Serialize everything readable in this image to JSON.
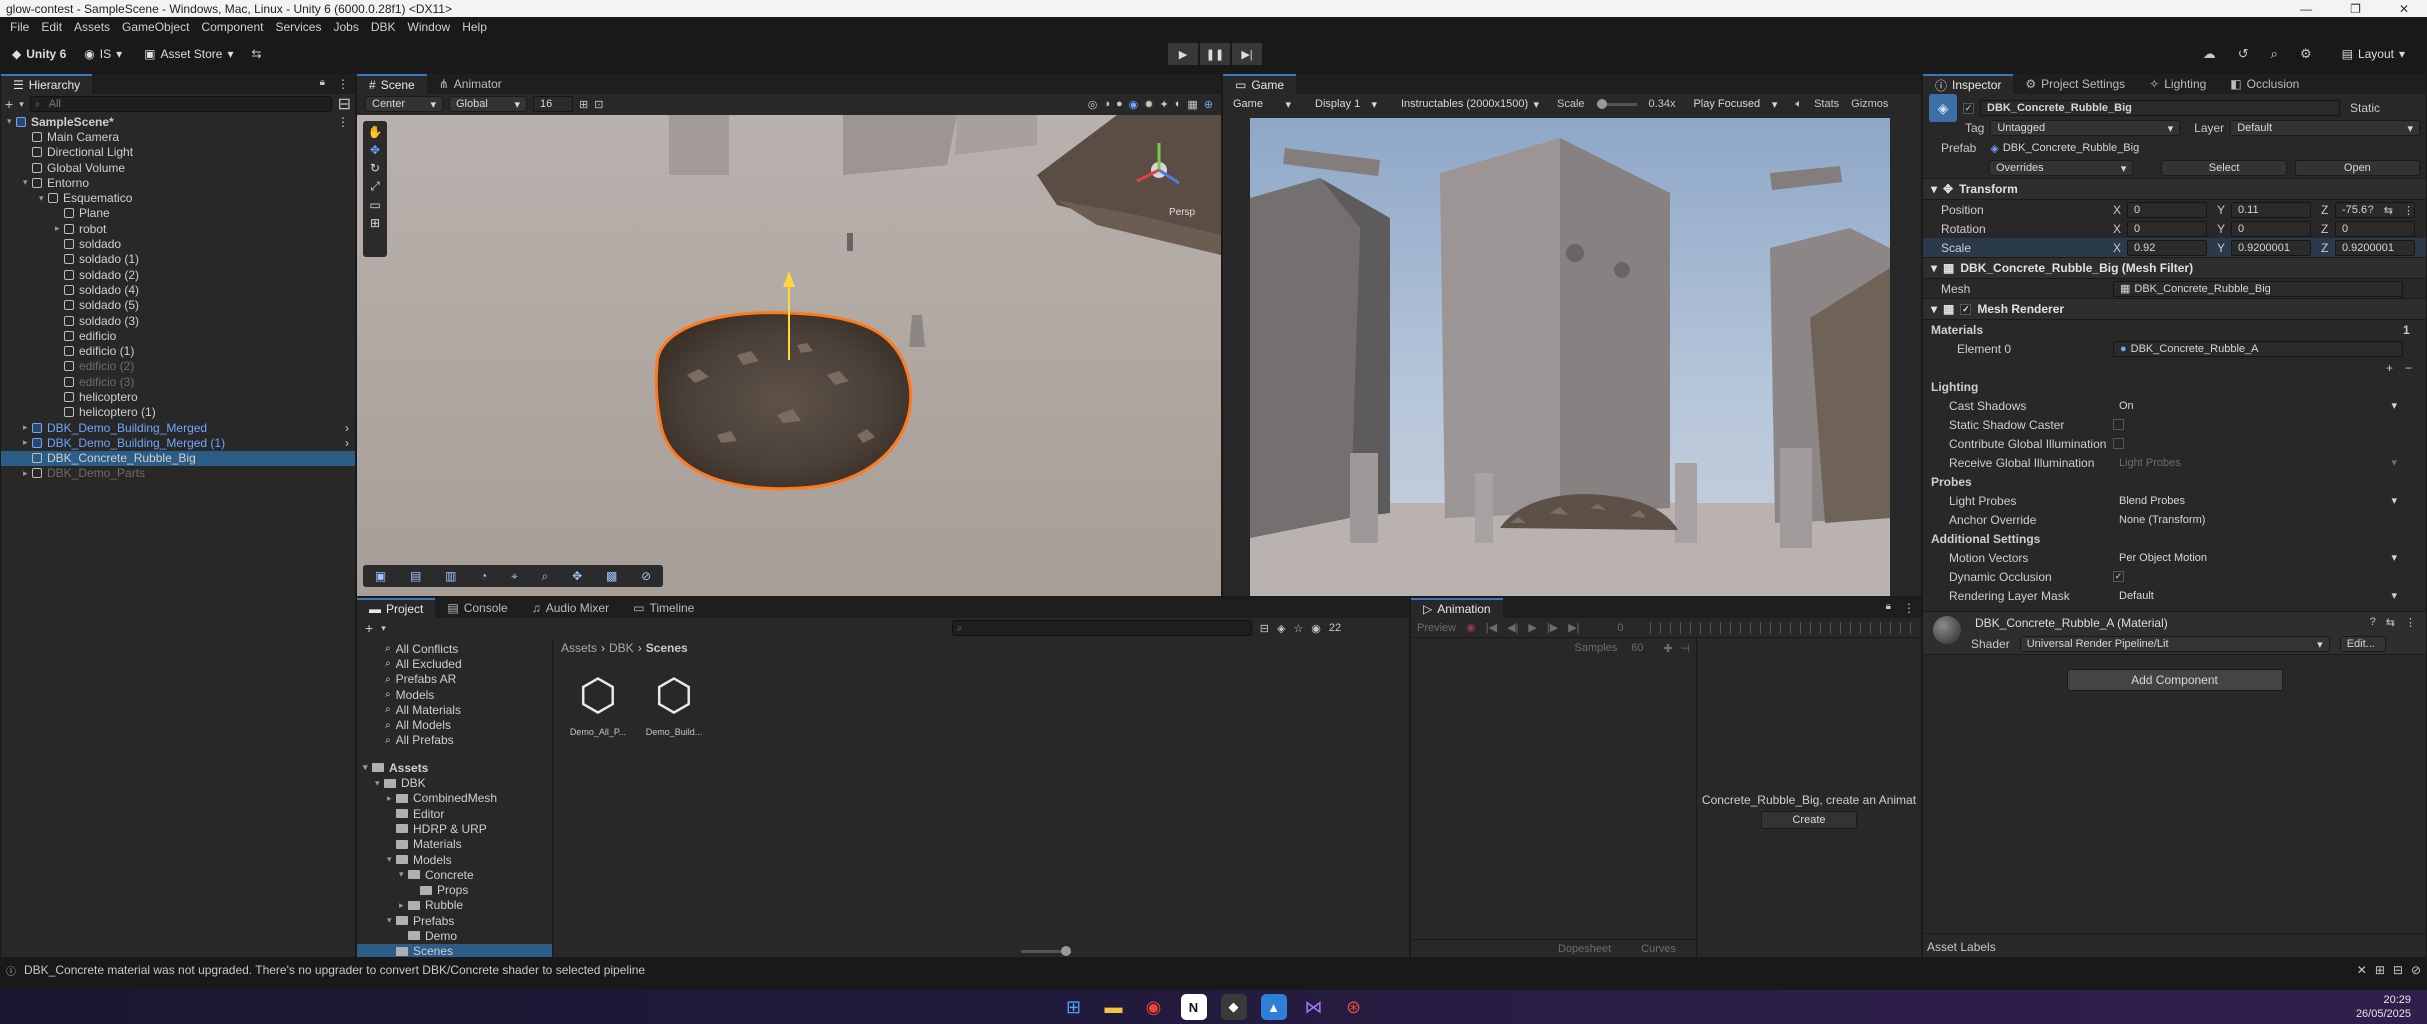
{
  "window": {
    "title": "glow-contest - SampleScene - Windows, Mac, Linux - Unity 6 (6000.0.28f1) <DX11>"
  },
  "menu": [
    "File",
    "Edit",
    "Assets",
    "GameObject",
    "Component",
    "Services",
    "Jobs",
    "DBK",
    "Window",
    "Help"
  ],
  "toolbar": {
    "account": "Unity 6",
    "user": "IS",
    "asset_store": "Asset Store",
    "layout": "Layout"
  },
  "hierarchy": {
    "tab": "Hierarchy",
    "search_placeholder": "All",
    "items": [
      {
        "label": "SampleScene*",
        "indent": 0,
        "style": "scene",
        "fold": "▾"
      },
      {
        "label": "Main Camera",
        "indent": 1,
        "style": "normal",
        "fold": ""
      },
      {
        "label": "Directional Light",
        "indent": 1,
        "style": "normal",
        "fold": ""
      },
      {
        "label": "Global Volume",
        "indent": 1,
        "style": "normal",
        "fold": ""
      },
      {
        "label": "Entorno",
        "indent": 1,
        "style": "normal",
        "fold": "▾"
      },
      {
        "label": "Esquematico",
        "indent": 2,
        "style": "normal",
        "fold": "▾"
      },
      {
        "label": "Plane",
        "indent": 3,
        "style": "normal",
        "fold": ""
      },
      {
        "label": "robot",
        "indent": 3,
        "style": "normal",
        "fold": "▸"
      },
      {
        "label": "soldado",
        "indent": 3,
        "style": "normal",
        "fold": ""
      },
      {
        "label": "soldado (1)",
        "indent": 3,
        "style": "normal",
        "fold": ""
      },
      {
        "label": "soldado (2)",
        "indent": 3,
        "style": "normal",
        "fold": ""
      },
      {
        "label": "soldado (4)",
        "indent": 3,
        "style": "normal",
        "fold": ""
      },
      {
        "label": "soldado (5)",
        "indent": 3,
        "style": "normal",
        "fold": ""
      },
      {
        "label": "soldado (3)",
        "indent": 3,
        "style": "normal",
        "fold": ""
      },
      {
        "label": "edificio",
        "indent": 3,
        "style": "normal",
        "fold": ""
      },
      {
        "label": "edificio (1)",
        "indent": 3,
        "style": "normal",
        "fold": ""
      },
      {
        "label": "edificio (2)",
        "indent": 3,
        "style": "dim",
        "fold": ""
      },
      {
        "label": "edificio (3)",
        "indent": 3,
        "style": "dim",
        "fold": ""
      },
      {
        "label": "helicoptero",
        "indent": 3,
        "style": "normal",
        "fold": ""
      },
      {
        "label": "helicoptero (1)",
        "indent": 3,
        "style": "normal",
        "fold": ""
      },
      {
        "label": "DBK_Demo_Building_Merged",
        "indent": 1,
        "style": "blue",
        "fold": "▸"
      },
      {
        "label": "DBK_Demo_Building_Merged (1)",
        "indent": 1,
        "style": "blue",
        "fold": "▸"
      },
      {
        "label": "DBK_Concrete_Rubble_Big",
        "indent": 1,
        "style": "selected",
        "fold": ""
      },
      {
        "label": "DBK_Demo_Parts",
        "indent": 1,
        "style": "dim",
        "fold": "▸"
      }
    ]
  },
  "scene": {
    "tabs": [
      "Scene",
      "Animator"
    ],
    "pivot": "Center",
    "space": "Global",
    "grid_size": "16",
    "gizmo_label": "Persp"
  },
  "game": {
    "tab": "Game",
    "mode": "Game",
    "display": "Display 1",
    "resolution": "Instructables (2000x1500)",
    "scale_label": "Scale",
    "scale_value": "0.34x",
    "play_mode": "Play Focused",
    "stats": "Stats",
    "gizmos": "Gizmos"
  },
  "project": {
    "tabs": [
      "Project",
      "Console",
      "Audio Mixer",
      "Timeline"
    ],
    "favorites": [
      "All Conflicts",
      "All Excluded",
      "Prefabs AR",
      "Models",
      "All Materials",
      "All Models",
      "All Prefabs"
    ],
    "assets_root": "Assets",
    "tree": [
      {
        "label": "DBK",
        "indent": 1,
        "fold": "▾"
      },
      {
        "label": "CombinedMesh",
        "indent": 2,
        "fold": "▸"
      },
      {
        "label": "Editor",
        "indent": 2,
        "fold": ""
      },
      {
        "label": "HDRP & URP",
        "indent": 2,
        "fold": ""
      },
      {
        "label": "Materials",
        "indent": 2,
        "fold": ""
      },
      {
        "label": "Models",
        "indent": 2,
        "fold": "▾"
      },
      {
        "label": "Concrete",
        "indent": 3,
        "fold": "▾"
      },
      {
        "label": "Props",
        "indent": 4,
        "fold": ""
      },
      {
        "label": "Rubble",
        "indent": 3,
        "fold": "▸"
      },
      {
        "label": "Prefabs",
        "indent": 2,
        "fold": "▾"
      },
      {
        "label": "Demo",
        "indent": 3,
        "fold": ""
      },
      {
        "label": "Scenes",
        "indent": 2,
        "fold": ""
      }
    ],
    "breadcrumb": [
      "Assets",
      "DBK",
      "Scenes"
    ],
    "files": [
      "Demo_All_P...",
      "Demo_Build..."
    ],
    "count_badge": "22"
  },
  "animation": {
    "tab": "Animation",
    "preview": "Preview",
    "samples_label": "Samples",
    "samples_value": "60",
    "frame": "0",
    "message": "Concrete_Rubble_Big, create an Animat",
    "create": "Create",
    "dopesheet": "Dopesheet",
    "curves": "Curves"
  },
  "inspector": {
    "tabs": [
      "Inspector",
      "Project Settings",
      "Lighting",
      "Occlusion"
    ],
    "object_name": "DBK_Concrete_Rubble_Big",
    "static_label": "Static",
    "tag_label": "Tag",
    "tag": "Untagged",
    "layer_label": "Layer",
    "layer": "Default",
    "prefab_label": "Prefab",
    "prefab_value": "DBK_Concrete_Rubble_Big",
    "overrides": "Overrides",
    "select": "Select",
    "open": "Open",
    "transform": {
      "title": "Transform",
      "position_label": "Position",
      "position": [
        "0",
        "0.11",
        "-75.6"
      ],
      "rotation_label": "Rotation",
      "rotation": [
        "0",
        "0",
        "0"
      ],
      "scale_label": "Scale",
      "scale": [
        "0.92",
        "0.9200001",
        "0.9200001"
      ]
    },
    "mesh_filter": {
      "title": "DBK_Concrete_Rubble_Big (Mesh Filter)",
      "mesh_label": "Mesh",
      "mesh": "DBK_Concrete_Rubble_Big"
    },
    "mesh_renderer": {
      "title": "Mesh Renderer",
      "materials_label": "Materials",
      "materials_count": "1",
      "element_label": "Element 0",
      "element": "DBK_Concrete_Rubble_A",
      "lighting_label": "Lighting",
      "cast_shadows_label": "Cast Shadows",
      "cast_shadows": "On",
      "static_shadow_label": "Static Shadow Caster",
      "contribute_gi_label": "Contribute Global Illumination",
      "receive_gi_label": "Receive Global Illumination",
      "receive_gi": "Light Probes",
      "probes_label": "Probes",
      "light_probes_label": "Light Probes",
      "light_probes": "Blend Probes",
      "anchor_label": "Anchor Override",
      "anchor": "None (Transform)",
      "additional_label": "Additional Settings",
      "motion_label": "Motion Vectors",
      "motion": "Per Object Motion",
      "dynamic_occ_label": "Dynamic Occlusion",
      "rendering_layer_label": "Rendering Layer Mask",
      "rendering_layer": "Default"
    },
    "material": {
      "title": "DBK_Concrete_Rubble_A (Material)",
      "shader_label": "Shader",
      "shader": "Universal Render Pipeline/Lit",
      "edit": "Edit..."
    },
    "add_component": "Add Component",
    "asset_labels": "Asset Labels"
  },
  "status": {
    "message": "DBK_Concrete material was not upgraded. There's no upgrader to convert DBK/Concrete shader to selected pipeline"
  },
  "clock": {
    "time": "20:29",
    "date": "26/05/2025"
  }
}
